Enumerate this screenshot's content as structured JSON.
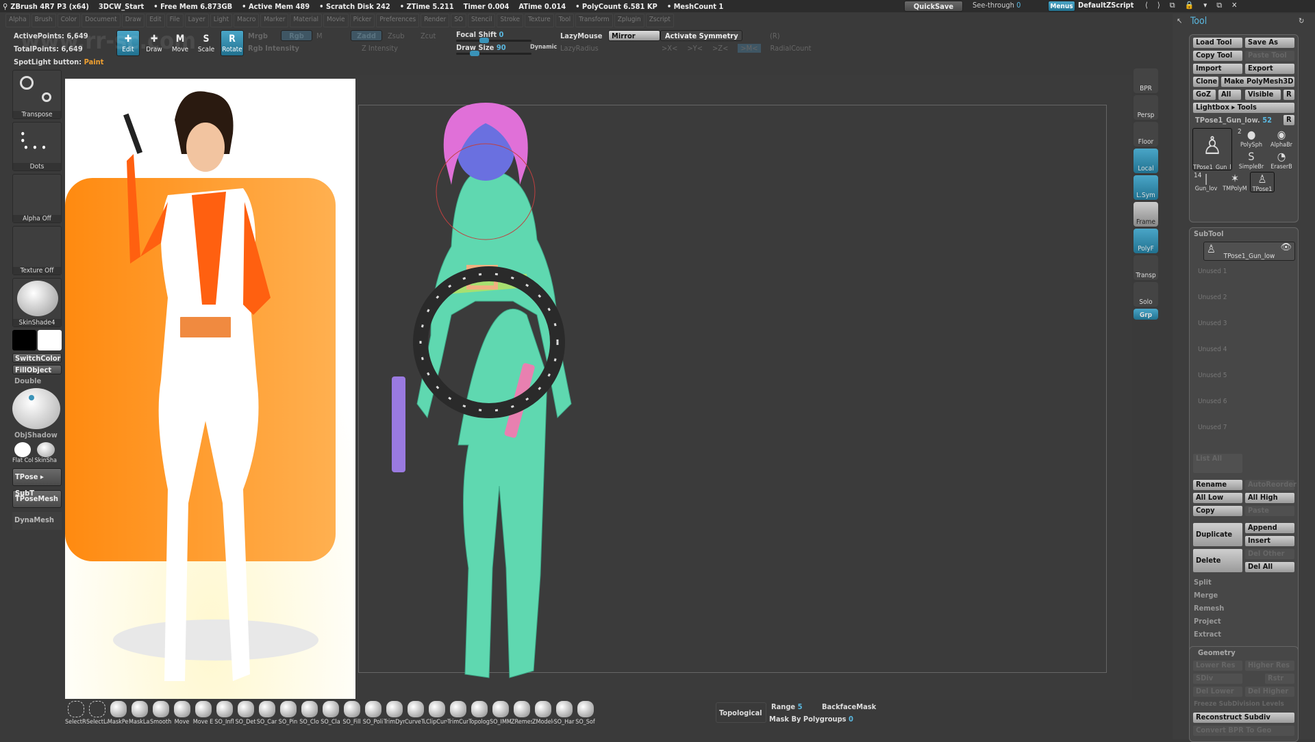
{
  "titlebar": {
    "app": "ZBrush 4R7 P3 (x64)",
    "doc": "3DCW_Start",
    "free_mem": "• Free Mem 6.873GB",
    "active_mem": "• Active Mem 489",
    "scratch": "• Scratch Disk 242",
    "ztime": "• ZTime 5.211",
    "timer": "Timer 0.004",
    "atime": "ATime 0.014",
    "polycount": "• PolyCount 6.581 KP",
    "meshcount": "• MeshCount 1",
    "quicksave": "QuickSave",
    "seethrough": "See-through",
    "seethrough_value": "0",
    "menus": "Menus",
    "script": "DefaultZScript"
  },
  "menus": [
    "Alpha",
    "Brush",
    "Color",
    "Document",
    "Draw",
    "Edit",
    "File",
    "Layer",
    "Light",
    "Macro",
    "Marker",
    "Material",
    "Movie",
    "Picker",
    "Preferences",
    "Render",
    "SO",
    "Stencil",
    "Stroke",
    "Texture",
    "Tool",
    "Transform",
    "Zplugin",
    "Zscript"
  ],
  "stats": {
    "active": "ActivePoints: 6,649",
    "total": "TotalPoints: 6,649",
    "spotlight": "SpotLight button:",
    "spotlight_value": "Paint"
  },
  "modes": [
    {
      "label": "Edit",
      "key": "",
      "active": true
    },
    {
      "label": "Draw",
      "active": false
    },
    {
      "label": "Move",
      "key": "M",
      "active": false
    },
    {
      "label": "Scale",
      "key": "S",
      "active": false
    },
    {
      "label": "Rotate",
      "key": "R",
      "active": true
    }
  ],
  "topctl": {
    "mrgb": "Mrgb",
    "rgb": "Rgb",
    "m": "M",
    "rgb_intensity": "Rgb Intensity",
    "zadd": "Zadd",
    "zsub": "Zsub",
    "zcut": "Zcut",
    "z_intensity": "Z Intensity",
    "focal": "Focal Shift",
    "focal_value": "0",
    "draw_size": "Draw Size",
    "draw_size_value": "90",
    "dynamic": "Dynamic",
    "lazymouse": "LazyMouse",
    "lazyradius": "LazyRadius",
    "mirror": "Mirror",
    "symmetry": "Activate Symmetry",
    "sym_r": "(R)",
    "x": ">X<",
    "y": ">Y<",
    "z": ">Z<",
    "m_btn": ">M<",
    "radial": "RadialCount"
  },
  "lefttray": {
    "tiles": [
      "Transpose",
      "Dots",
      "Alpha Off",
      "Texture Off",
      "SkinShade4"
    ],
    "switchcolor": "SwitchColor",
    "fillobject": "FillObject",
    "double": "Double",
    "objshadow": "ObjShadow",
    "flat": "Flat",
    "col": "Col",
    "skinsha": "SkinSha",
    "tpose_sub": "TPose ▸ SubT",
    "tposemesh": "TPoseMesh",
    "dynamesh": "DynaMesh"
  },
  "rshelf": [
    "BPR",
    "Persp",
    "Floor",
    "Local",
    "L.Sym",
    "Frame",
    "PolyF",
    "Transp",
    "Solo",
    "Grp"
  ],
  "tool": {
    "title": "Tool",
    "load": "Load Tool",
    "save": "Save As",
    "copy": "Copy Tool",
    "paste": "Paste Tool",
    "import": "Import",
    "export": "Export",
    "clone": "Clone",
    "make": "Make PolyMesh3D",
    "goz": "GoZ",
    "all": "All",
    "visible": "Visible",
    "r": "R",
    "lightbox": "Lightbox ▸ Tools",
    "current": "TPose1_Gun_low.",
    "current_value": "52",
    "thumbs": [
      "TPose1_Gun_lo",
      "PolySph",
      "AlphaBr",
      "SimpleBr",
      "EraserB",
      "Gun_lov",
      "TMPolyM",
      "TPose1"
    ],
    "count2": "2",
    "count14": "14"
  },
  "subtool": {
    "title": "SubTool",
    "item": "TPose1_Gun_low",
    "unused": [
      "Unused 1",
      "Unused 2",
      "Unused 3",
      "Unused 4",
      "Unused 5",
      "Unused 6",
      "Unused 7"
    ],
    "list_all": "List All",
    "rename": "Rename",
    "autoreorder": "AutoReorder",
    "all_low": "All Low",
    "all_high": "All High",
    "copy": "Copy",
    "paste": "Paste",
    "duplicate": "Duplicate",
    "append": "Append",
    "insert": "Insert",
    "delete": "Delete",
    "del_other": "Del Other",
    "del_all": "Del All",
    "split": "Split",
    "merge": "Merge",
    "remesh": "Remesh",
    "project": "Project",
    "extract": "Extract"
  },
  "geometry": {
    "title": "Geometry",
    "lower": "Lower Res",
    "higher": "Higher Res",
    "sdiv": "SDiv",
    "rstr": "Rstr",
    "del_lower": "Del Lower",
    "del_higher": "Del Higher",
    "freeze": "Freeze SubDivision Levels",
    "reconstruct": "Reconstruct Subdiv",
    "convert": "Convert BPR To Geo"
  },
  "bottom": {
    "brushes": [
      "SelectRe",
      "SelectLa",
      "MaskPen",
      "MaskLas",
      "Smooth",
      "Move",
      "Move E",
      "SO_Infl",
      "SO_Det",
      "SO_Car",
      "SO_Pin",
      "SO_Clo",
      "SO_Cla",
      "SO_Fill",
      "SO_Poli",
      "TrimDyn",
      "CurveTu",
      "ClipCurv",
      "TrimCur",
      "Topolog",
      "SO_IMM",
      "ZRemesh",
      "ZModele",
      "SO_Har",
      "SO_Sof"
    ],
    "topological": "Topological",
    "range": "Range",
    "range_value": "5",
    "backface": "BackfaceMask",
    "mask_polygroups": "Mask By Polygroups",
    "mask_polygroups_value": "0"
  },
  "watermark": "www.rr-sc.com",
  "colors": {
    "accent": "#3a93b8",
    "highlight": "#f0a030",
    "model": "#5fd8b0",
    "hair": "#e070d8"
  }
}
